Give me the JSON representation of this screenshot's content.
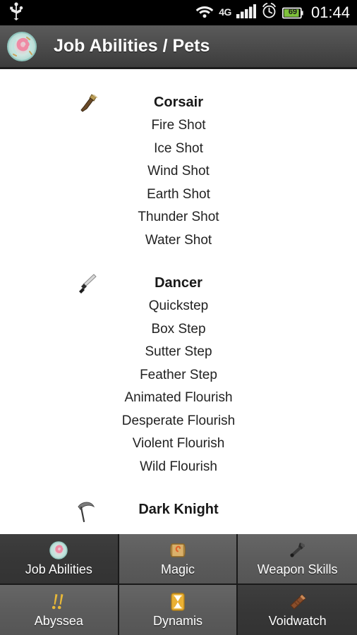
{
  "statusbar": {
    "time": "01:44",
    "battery_percent": "69",
    "network_label": "4G",
    "icons": [
      "usb-icon",
      "wifi-icon",
      "network-4g-icon",
      "signal-bars-icon",
      "alarm-clock-icon",
      "battery-icon"
    ]
  },
  "titlebar": {
    "title": "Job Abilities / Pets",
    "icon": "app-logo-icon"
  },
  "content": {
    "groups": [
      {
        "name": "Corsair",
        "icon": "gun-icon",
        "abilities": [
          "Fire Shot",
          "Ice Shot",
          "Wind Shot",
          "Earth Shot",
          "Thunder Shot",
          "Water Shot"
        ]
      },
      {
        "name": "Dancer",
        "icon": "dagger-icon",
        "abilities": [
          "Quickstep",
          "Box Step",
          "Sutter Step",
          "Feather Step",
          "Animated Flourish",
          "Desperate Flourish",
          "Violent Flourish",
          "Wild Flourish"
        ]
      },
      {
        "name": "Dark Knight",
        "icon": "scythe-icon",
        "abilities": []
      }
    ]
  },
  "tabs": [
    {
      "label": "Job Abilities",
      "icon": "app-logo-icon",
      "selected": true
    },
    {
      "label": "Magic",
      "icon": "scroll-icon",
      "selected": false
    },
    {
      "label": "Weapon Skills",
      "icon": "axe-icon",
      "selected": false
    },
    {
      "label": "Abyssea",
      "icon": "double-exclamation-icon",
      "selected": false
    },
    {
      "label": "Dynamis",
      "icon": "hourglass-icon",
      "selected": false
    },
    {
      "label": "Voidwatch",
      "icon": "log-icon",
      "selected": true
    }
  ],
  "colors": {
    "statusbar_bg": "#000000",
    "titlebar_bg": "#4d4d4d",
    "content_bg": "#ffffff",
    "tab_bg": "#5c5c5c",
    "tab_selected_bg": "#373737",
    "battery_green": "#7ec13a"
  }
}
